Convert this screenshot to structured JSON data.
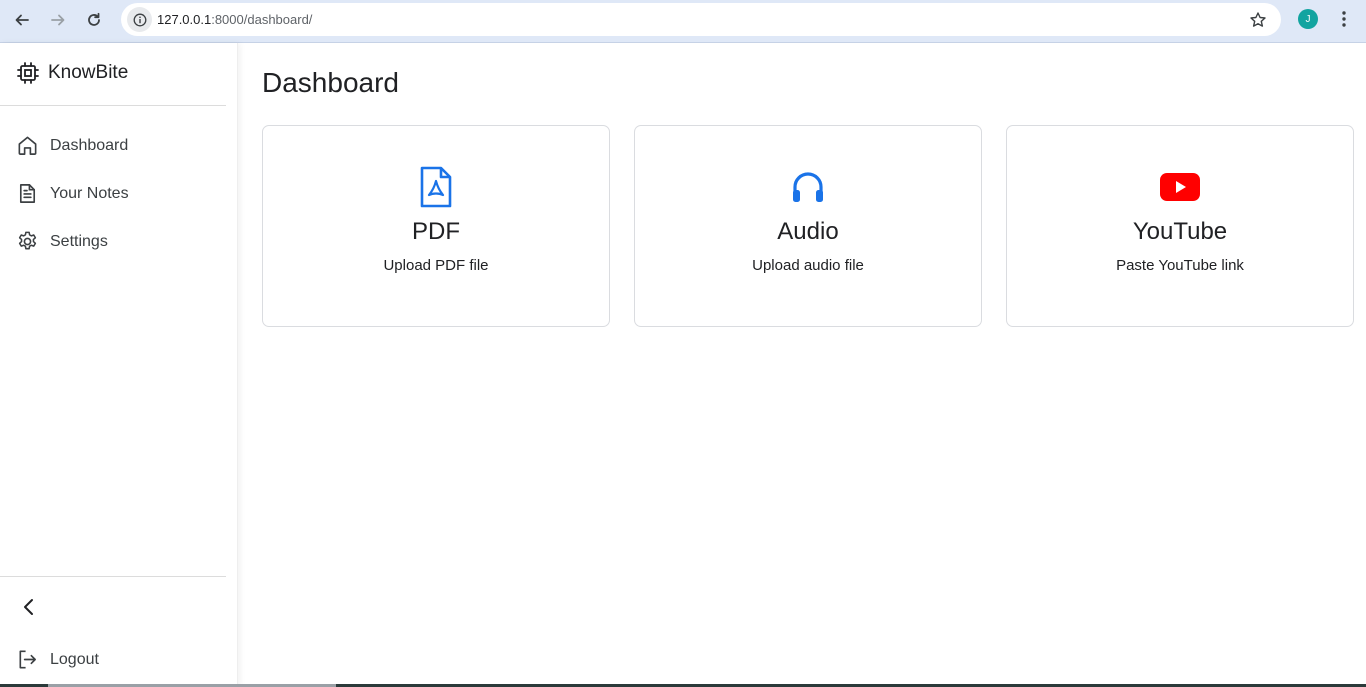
{
  "browser": {
    "url_host": "127.0.0.1",
    "url_path": ":8000/dashboard/",
    "profile_initial": "J"
  },
  "sidebar": {
    "brand": "KnowBite",
    "items": [
      {
        "label": "Dashboard",
        "icon": "home-icon"
      },
      {
        "label": "Your Notes",
        "icon": "document-icon"
      },
      {
        "label": "Settings",
        "icon": "gear-icon"
      }
    ],
    "logout_label": "Logout"
  },
  "main": {
    "title": "Dashboard",
    "cards": [
      {
        "title": "PDF",
        "subtitle": "Upload PDF file",
        "icon": "pdf-file-icon",
        "color": "#1a73e8"
      },
      {
        "title": "Audio",
        "subtitle": "Upload audio file",
        "icon": "headphones-icon",
        "color": "#1a73e8"
      },
      {
        "title": "YouTube",
        "subtitle": "Paste YouTube link",
        "icon": "youtube-icon",
        "color": "#ff0000"
      }
    ]
  },
  "colors": {
    "chrome_bg": "#dfe8f7",
    "accent": "#1a73e8",
    "youtube_red": "#ff0000",
    "profile_bg": "#12a4a0"
  }
}
